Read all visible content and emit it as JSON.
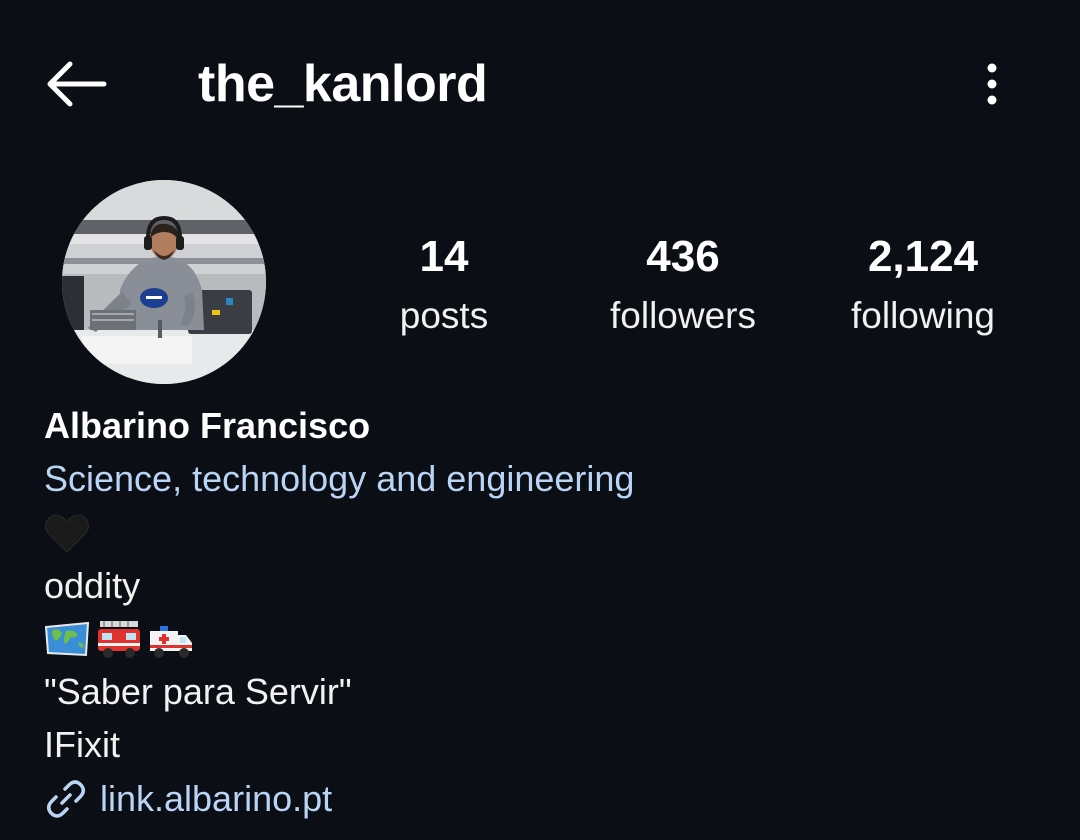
{
  "header": {
    "back_icon": "arrow-left-icon",
    "username": "the_kanlord",
    "more_icon": "more-vertical-icon"
  },
  "profile": {
    "avatar_icon": "profile-photo",
    "stats": [
      {
        "value": "14",
        "label": "posts"
      },
      {
        "value": "436",
        "label": "followers"
      },
      {
        "value": "2,124",
        "label": "following"
      }
    ]
  },
  "bio": {
    "full_name": "Albarino Francisco",
    "category": "Science, technology and engineering",
    "heart_icon": "black-heart-icon",
    "line_oddity": "oddity",
    "emoji_icons": [
      "world-map-icon",
      "fire-engine-icon",
      "ambulance-icon"
    ],
    "motto": "\"Saber para Servir\"",
    "line_ifixit": "IFixit",
    "link_icon": "link-icon",
    "link": "link.albarino.pt"
  },
  "colors": {
    "background": "#0b0e14",
    "accent_link": "#b9d4f5",
    "text": "#ffffff"
  }
}
